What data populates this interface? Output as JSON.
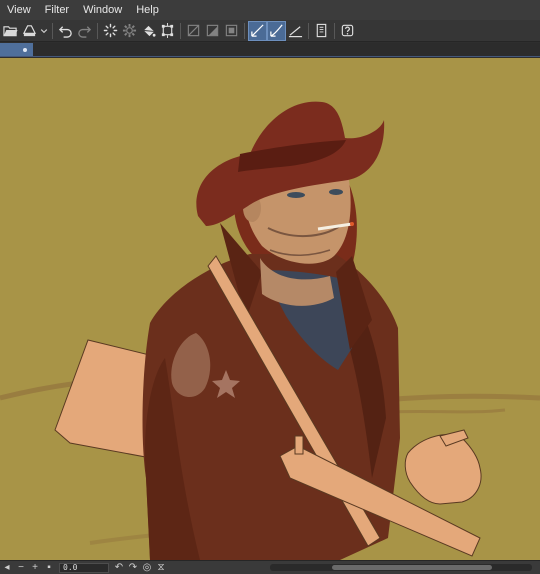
{
  "menu": {
    "items": [
      {
        "label": "View"
      },
      {
        "label": "Filter"
      },
      {
        "label": "Window"
      },
      {
        "label": "Help"
      }
    ]
  },
  "toolbar": {
    "icons": [
      "open-folder-icon",
      "save-icon",
      "dropdown-caret-icon",
      "undo-icon",
      "redo-icon",
      "loading-spinner-icon",
      "settings-gear-icon",
      "fill-bucket-icon",
      "transform-icon",
      "clear-icon",
      "fill-selection-icon",
      "invert-selection-icon",
      "snap-ruler-icon",
      "snap-special-ruler-icon",
      "ruler-line-icon",
      "tablet-icon",
      "help-icon"
    ],
    "active_tools": [
      "snap-ruler-icon",
      "snap-special-ruler-icon"
    ]
  },
  "document_tab": {
    "modified": true
  },
  "statusbar": {
    "zoom_value": "0.0"
  },
  "colors": {
    "canvas_background": "#a89447",
    "hat": "#7b2c1e",
    "coat": "#6b2f1c",
    "flat_skin": "#e4a87a",
    "scarf": "#3d4658",
    "accent_active": "#4b6b96"
  }
}
